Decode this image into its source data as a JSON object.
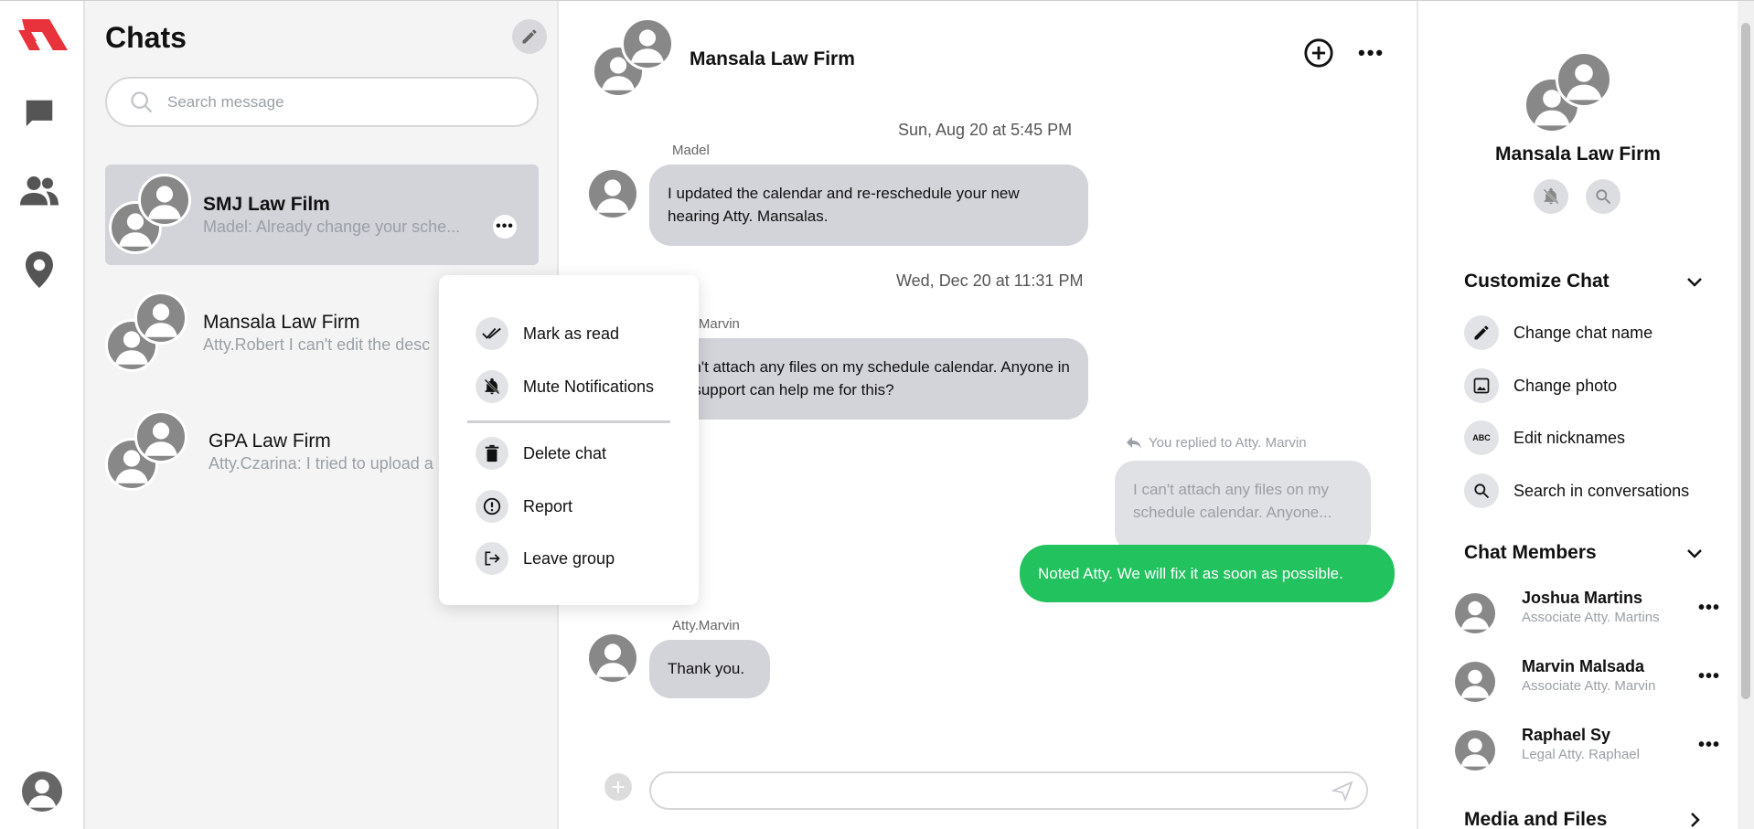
{
  "sidebar": {
    "items": [
      "logo",
      "chats",
      "contacts",
      "location",
      "profile"
    ]
  },
  "chats_panel": {
    "title": "Chats",
    "search_placeholder": "Search message",
    "items": [
      {
        "name": "SMJ Law Film",
        "preview": "Madel: Already change your sche..."
      },
      {
        "name": "Mansala Law Firm",
        "preview": "Atty.Robert I can't edit the desc"
      },
      {
        "name": "GPA Law Firm",
        "preview": "Atty.Czarina: I tried to upload a"
      }
    ]
  },
  "context_menu": {
    "items": [
      "Mark as read",
      "Mute Notifications",
      "Delete chat",
      "Report",
      "Leave group"
    ]
  },
  "conversation": {
    "title": "Mansala Law Firm",
    "messages": [
      {
        "timestamp": "Sun, Aug 20 at 5:45 PM",
        "sender": "Madel",
        "text": "I updated the calendar and re-reschedule your new hearing Atty. Mansalas."
      },
      {
        "timestamp": "Wed, Dec 20 at 11:31 PM",
        "sender": "Atty.Marvin",
        "text": "I can't attach any files on my schedule calendar. Anyone in the support can help me for this?"
      },
      {
        "reply_label": "You replied to Atty. Marvin",
        "quote": "I can't attach any files on my schedule calendar. Anyone...",
        "text": "Noted Atty. We will fix it as soon as possible."
      },
      {
        "sender": "Atty.Marvin",
        "text": "Thank you."
      }
    ],
    "composer_placeholder": ""
  },
  "info_panel": {
    "name": "Mansala Law Firm",
    "customize": {
      "title": "Customize Chat",
      "options": [
        "Change chat name",
        "Change photo",
        "Edit nicknames",
        "Search in conversations"
      ]
    },
    "members": {
      "title": "Chat Members",
      "list": [
        {
          "name": "Joshua Martins",
          "role": "Associate Atty. Martins"
        },
        {
          "name": "Marvin Malsada",
          "role": "Associate Atty. Marvin"
        },
        {
          "name": "Raphael Sy",
          "role": "Legal Atty. Raphael"
        }
      ]
    },
    "media_title": "Media and Files"
  },
  "colors": {
    "accent_red": "#e8323c",
    "sent_bubble": "#22c35e",
    "received_bubble": "#d3d4da"
  }
}
